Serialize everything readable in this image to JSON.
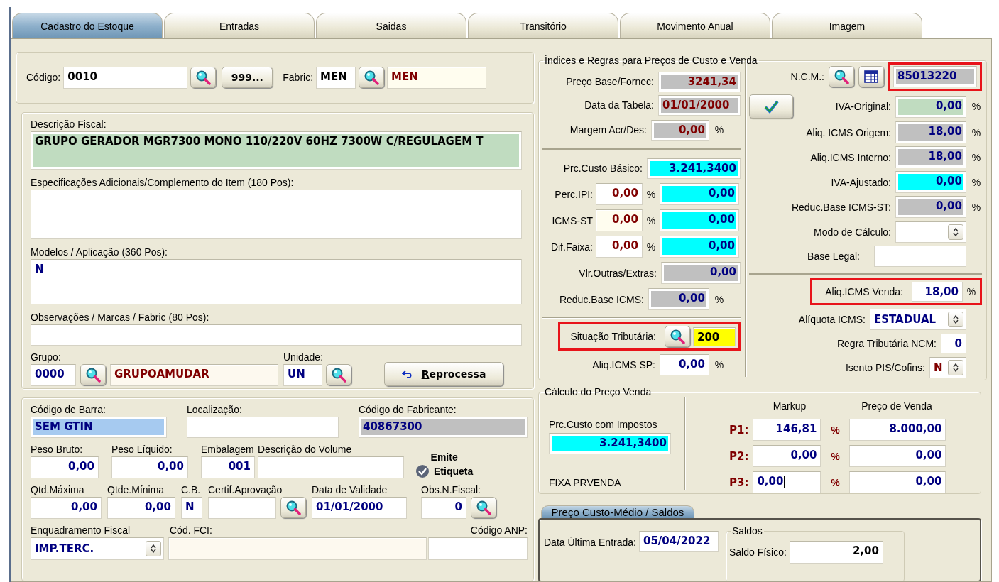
{
  "tabs": [
    {
      "label": "Cadastro do Estoque",
      "selected": true
    },
    {
      "label": "Entradas",
      "selected": false
    },
    {
      "label": "Saidas",
      "selected": false
    },
    {
      "label": "Transitório",
      "selected": false
    },
    {
      "label": "Movimento Anual",
      "selected": false
    },
    {
      "label": "Imagem",
      "selected": false
    }
  ],
  "codigo": {
    "label": "Código:",
    "value": "0010",
    "sequence_button": "999..."
  },
  "fabric": {
    "label": "Fabric:",
    "code": "MEN",
    "name": "MEN"
  },
  "descricao_fiscal": {
    "label": "Descrição Fiscal:",
    "value": "GRUPO GERADOR MGR7300 MONO 110/220V 60HZ 7300W C/REGULAGEM T"
  },
  "especificacoes": {
    "label": "Especificações Adicionais/Complemento do Item (180 Pos):"
  },
  "modelos": {
    "label": "Modelos / Aplicação (360 Pos):",
    "value": "N"
  },
  "observacoes": {
    "label": "Observações / Marcas / Fabric (80 Pos):"
  },
  "grupo": {
    "label": "Grupo:",
    "code": "0000",
    "name": "GRUPOAMUDAR"
  },
  "unidade": {
    "label": "Unidade:",
    "value": "UN"
  },
  "reprocess_button": "Reprocessa",
  "codigo_barra": {
    "label": "Código de Barra:",
    "value": "SEM GTIN"
  },
  "localizacao": {
    "label": "Localização:"
  },
  "codigo_fabricante": {
    "label": "Código do Fabricante:",
    "value": "40867300"
  },
  "peso_bruto": {
    "label": "Peso Bruto:",
    "value": "0,00"
  },
  "peso_liquido": {
    "label": "Peso Líquido:",
    "value": "0,00"
  },
  "embalagem": {
    "label": "Embalagem",
    "value": "001"
  },
  "descricao_volume": {
    "label": "Descrição do Volume"
  },
  "emite_etiqueta": {
    "label_top": "Emite",
    "label_bottom": "Etiqueta",
    "checked": true
  },
  "qtd_maxima": {
    "label": "Qtd.Máxima",
    "value": "0,00"
  },
  "qtde_minima": {
    "label": "Qtde.Mínima",
    "value": "0,00"
  },
  "cb": {
    "label": "C.B.",
    "value": "N"
  },
  "certif": {
    "label": "Certif.Aprovação"
  },
  "data_validade": {
    "label": "Data de Validade",
    "value": "01/01/2000"
  },
  "obs_nfiscal": {
    "label": "Obs.N.Fiscal:",
    "value": "0"
  },
  "enquadramento": {
    "label": "Enquadramento Fiscal",
    "value": "IMP.TERC."
  },
  "cod_fci": {
    "label": "Cód. FCI:"
  },
  "codigo_anp": {
    "label": "Código ANP:"
  },
  "indices": {
    "title": "Índices e Regras para Preços de Custo e Venda",
    "preco_base": {
      "label": "Preço Base/Fornec:",
      "value": "3241,34"
    },
    "data_tabela": {
      "label": "Data da Tabela:",
      "value": "01/01/2000"
    },
    "margem": {
      "label": "Margem Acr/Des:",
      "value": "0,00",
      "unit": "%"
    },
    "custo_basico": {
      "label": "Prc.Custo Básico:",
      "value": "3.241,3400"
    },
    "taxes": [
      {
        "label": "Perc.IPI:",
        "rate": "0,00",
        "unit": "%",
        "value": "0,00",
        "kind": "white"
      },
      {
        "label": "ICMS-ST",
        "rate": "0,00",
        "unit": "%",
        "value": "0,00",
        "kind": "cream"
      },
      {
        "label": "Dif.Faixa:",
        "rate": "0,00",
        "unit": "%",
        "value": "0,00",
        "kind": "white"
      }
    ],
    "outras": {
      "label": "Vlr.Outras/Extras:",
      "value": "0,00"
    },
    "reduc_base": {
      "label": "Reduc.Base ICMS:",
      "value": "0,00",
      "unit": "%"
    },
    "situacao": {
      "label": "Situação Tributária:",
      "value": "200",
      "highlighted": true
    },
    "aliq_sp": {
      "label": "Aliq.ICMS SP:",
      "value": "0,00",
      "unit": "%"
    },
    "ncm": {
      "label": "N.C.M.:",
      "value": "85013220",
      "highlighted": true
    },
    "rates": [
      {
        "label": "IVA-Original:",
        "value": "0,00",
        "unit": "%",
        "kind": "green"
      },
      {
        "label": "Aliq. ICMS Origem:",
        "value": "18,00",
        "unit": "%",
        "kind": "grey"
      },
      {
        "label": "Aliq.ICMS Interno:",
        "value": "18,00",
        "unit": "%",
        "kind": "grey"
      },
      {
        "label": "IVA-Ajustado:",
        "value": "0,00",
        "unit": "%",
        "kind": "cyan"
      },
      {
        "label": "Reduc.Base ICMS-ST:",
        "value": "0,00",
        "unit": "%",
        "kind": "grey"
      }
    ],
    "modo_calculo": {
      "label": "Modo de Cálculo:"
    },
    "base_legal": {
      "label": "Base Legal:"
    },
    "aliq_venda": {
      "label": "Aliq.ICMS Venda:",
      "value": "18,00",
      "unit": "%",
      "highlighted": true
    },
    "aliquota_icms": {
      "label": "Alíquota ICMS:",
      "value": "ESTADUAL"
    },
    "regra_ncm": {
      "label": "Regra Tributária NCM:",
      "value": "0"
    },
    "isento_pis": {
      "label": "Isento PIS/Cofins:",
      "value": "N"
    }
  },
  "calculo": {
    "title": "Cálculo do Preço Venda",
    "custo_label": "Prc.Custo com Impostos",
    "custo_value": "3.241,3400",
    "fixa_label": "FIXA PRVENDA",
    "markup_header": "Markup",
    "preco_header": "Preço de Venda",
    "prices": [
      {
        "label": "P1:",
        "markup": "146,81",
        "unit": "%",
        "price": "8.000,00",
        "editing": false
      },
      {
        "label": "P2:",
        "markup": "0,00",
        "unit": "%",
        "price": "0,00",
        "editing": false
      },
      {
        "label": "P3:",
        "markup": "0,00",
        "unit": "%",
        "price": "0,00",
        "editing": true
      }
    ]
  },
  "saldos_tab": {
    "label": "Preço Custo-Médio / Saldos",
    "selected": true
  },
  "ultima_entrada": {
    "label": "Data Última Entrada:",
    "value": "05/04/2022"
  },
  "saldos": {
    "title": "Saldos",
    "fisico_label": "Saldo Físico:",
    "fisico_value": "2,00"
  }
}
